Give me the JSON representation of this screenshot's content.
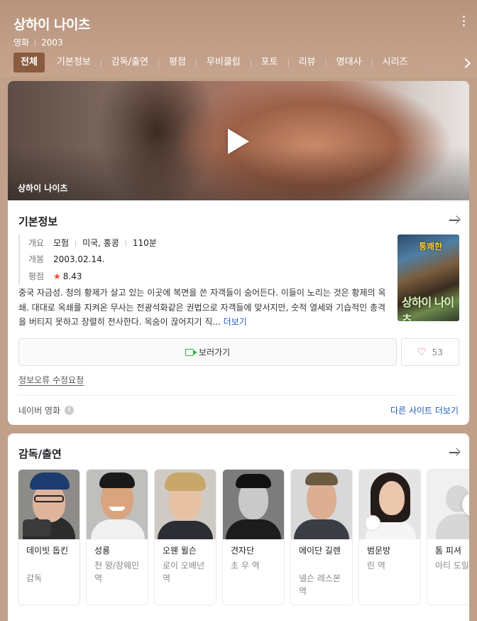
{
  "header": {
    "title": "상하이 나이츠",
    "category": "영화",
    "year": "2003"
  },
  "tabs": [
    {
      "label": "전체",
      "active": true
    },
    {
      "label": "기본정보"
    },
    {
      "label": "감독/출연"
    },
    {
      "label": "평점"
    },
    {
      "label": "무비클립"
    },
    {
      "label": "포토"
    },
    {
      "label": "리뷰"
    },
    {
      "label": "명대사"
    },
    {
      "label": "시리즈"
    }
  ],
  "video": {
    "label": "상하이 나이츠"
  },
  "basic_info": {
    "title": "기본정보",
    "summary_key": "개요",
    "genre": "모험",
    "country": "미국, 홍콩",
    "runtime": "110분",
    "release_key": "개봉",
    "release_date": "2003.02.14.",
    "rating_key": "평점",
    "rating": "8.43",
    "synopsis": "중국 자금성. 청의 황제가 살고 있는 이곳에 복면을 쓴 자객들이 숨어든다. 이들이 노리는 것은 황제의 옥쇄. 대대로 옥쇄를 지켜온 무사는 전광석화같은 권법으로 자객들에 맞서지만, 숫적 열세와 기습적인 총격을 버티지 못하고 장렬히 전사한다. 목숨이 끊어지기 직...",
    "more_label": "더보기",
    "poster": {
      "title": "상하이 나이츠",
      "top_text": "통쾌한"
    }
  },
  "actions": {
    "watch_label": "보러가기",
    "like_count": "53"
  },
  "report_label": "정보오류 수정요청",
  "footer": {
    "source": "네이버 영화",
    "other_sites": "다른 사이트 더보기"
  },
  "cast_section": {
    "title": "감독/출연",
    "people": [
      {
        "name": "데이빗 돕킨",
        "role": "감독"
      },
      {
        "name": "성룡",
        "role": "천 왕/장웨인 역"
      },
      {
        "name": "오웬 윌슨",
        "role": "로이 오배넌 역"
      },
      {
        "name": "견자단",
        "role": "초 우 역"
      },
      {
        "name": "에이단 길렌",
        "role": "넬슨 레스본 역"
      },
      {
        "name": "범문방",
        "role": "린 역"
      },
      {
        "name": "톰 피셔",
        "role": "아티 도일 역"
      }
    ]
  },
  "colors": {
    "header_bg": "#c1a08a",
    "active_tab": "#8a5b3e",
    "link": "#1f5bb8",
    "star": "#e8493a",
    "watch_icon": "#26b340"
  }
}
